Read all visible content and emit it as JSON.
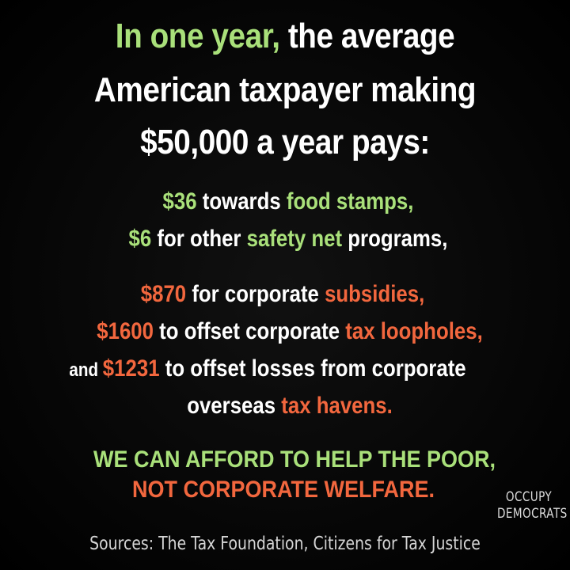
{
  "headline": {
    "line1_green": "In one year,",
    "line1_white": " the average",
    "line2": "American taxpayer making",
    "line3": "$50,000 a year pays:"
  },
  "items": [
    {
      "amount": "$36",
      "text_a": " towards ",
      "highlight": "food stamps,",
      "text_b": ""
    },
    {
      "amount": "$6",
      "text_a": " for other ",
      "highlight": "safety net",
      "text_b": " programs,"
    },
    {
      "amount": "$870",
      "text_a": " for corporate ",
      "highlight": "subsidies,",
      "text_b": ""
    },
    {
      "amount": "$1600",
      "text_a": " to offset corporate ",
      "highlight": "tax loopholes,",
      "text_b": ""
    },
    {
      "prefix": "and ",
      "amount": "$1231",
      "text_a": " to offset losses from corporate"
    },
    {
      "text_a": "overseas ",
      "highlight": "tax havens."
    }
  ],
  "slogan": {
    "line1": "WE CAN AFFORD TO HELP THE POOR,",
    "line2": "NOT CORPORATE WELFARE."
  },
  "brand": {
    "line1": "OCCUPY",
    "line2": "DEMOCRATS"
  },
  "sources": "Sources: The Tax Foundation, Citizens for Tax Justice",
  "colors": {
    "background": "#050505",
    "green": "#a9e07a",
    "red": "#f2673e",
    "white": "#ffffff"
  }
}
